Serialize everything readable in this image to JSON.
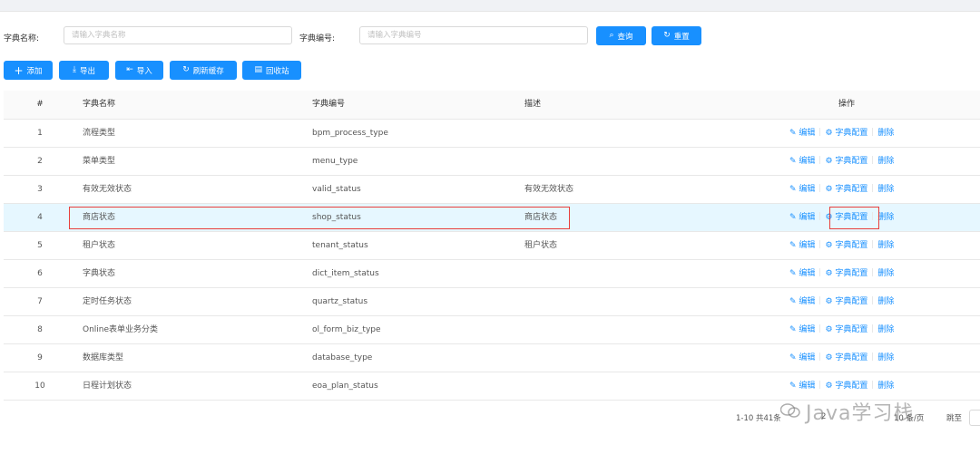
{
  "search": {
    "name_label": "字典名称:",
    "name_placeholder": "请输入字典名称",
    "code_label": "字典编号:",
    "code_placeholder": "请输入字典编号",
    "query_label": "查询",
    "reset_label": "重置"
  },
  "toolbar": {
    "add": "添加",
    "export": "导出",
    "import": "导入",
    "refresh_cache": "刷新缓存",
    "recycle": "回收站"
  },
  "table": {
    "headers": {
      "index": "#",
      "name": "字典名称",
      "code": "字典编号",
      "desc": "描述",
      "ops": "操作"
    },
    "op_labels": {
      "edit": "编辑",
      "config": "字典配置",
      "delete": "删除"
    },
    "rows": [
      {
        "index": "1",
        "name": "流程类型",
        "code": "bpm_process_type",
        "desc": ""
      },
      {
        "index": "2",
        "name": "菜单类型",
        "code": "menu_type",
        "desc": ""
      },
      {
        "index": "3",
        "name": "有效无效状态",
        "code": "valid_status",
        "desc": "有效无效状态"
      },
      {
        "index": "4",
        "name": "商店状态",
        "code": "shop_status",
        "desc": "商店状态"
      },
      {
        "index": "5",
        "name": "租户状态",
        "code": "tenant_status",
        "desc": "租户状态"
      },
      {
        "index": "6",
        "name": "字典状态",
        "code": "dict_item_status",
        "desc": ""
      },
      {
        "index": "7",
        "name": "定时任务状态",
        "code": "quartz_status",
        "desc": ""
      },
      {
        "index": "8",
        "name": "Online表单业务分类",
        "code": "ol_form_biz_type",
        "desc": ""
      },
      {
        "index": "9",
        "name": "数据库类型",
        "code": "database_type",
        "desc": ""
      },
      {
        "index": "10",
        "name": "日程计划状态",
        "code": "eoa_plan_status",
        "desc": ""
      }
    ]
  },
  "pagination": {
    "summary": "1-10 共41条",
    "page2": "2",
    "page_size": "10 条/页",
    "jump": "跳至"
  },
  "watermark": "Java学习栈",
  "colors": {
    "primary": "#1890ff",
    "highlight_row": "#e6f7ff",
    "annotation": "#e8403c"
  }
}
